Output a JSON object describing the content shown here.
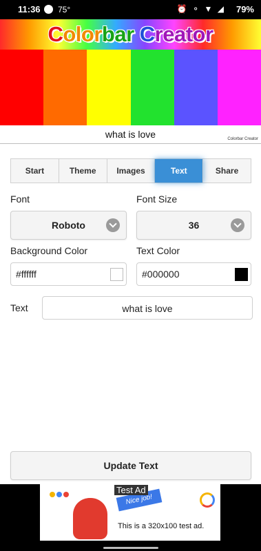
{
  "status_bar": {
    "time": "11:36",
    "temperature": "75°",
    "battery": "79%"
  },
  "header": {
    "title_parts": [
      "C",
      "olor",
      "bar ",
      "C",
      "reator"
    ],
    "title": "Colorbar Creator"
  },
  "preview": {
    "bar_colors": [
      "#ff0000",
      "#ff6a00",
      "#ffff00",
      "#22e22e",
      "#5b53ff",
      "#ff22ff"
    ],
    "caption": "what is love",
    "watermark": "Colorbar Creator"
  },
  "tabs": [
    {
      "label": "Start"
    },
    {
      "label": "Theme"
    },
    {
      "label": "Images"
    },
    {
      "label": "Text",
      "active": true
    },
    {
      "label": "Share"
    }
  ],
  "form": {
    "font_label": "Font",
    "font_value": "Roboto",
    "font_size_label": "Font Size",
    "font_size_value": "36",
    "bg_color_label": "Background Color",
    "bg_color_value": "#ffffff",
    "text_color_label": "Text Color",
    "text_color_value": "#000000",
    "text_label": "Text",
    "text_value": "what is love"
  },
  "actions": {
    "update_label": "Update Text"
  },
  "ad": {
    "badge": "Test Ad",
    "ribbon": "Nice job!",
    "text": "This is a 320x100 test ad."
  },
  "colors": {
    "accent": "#3a8fd6"
  }
}
